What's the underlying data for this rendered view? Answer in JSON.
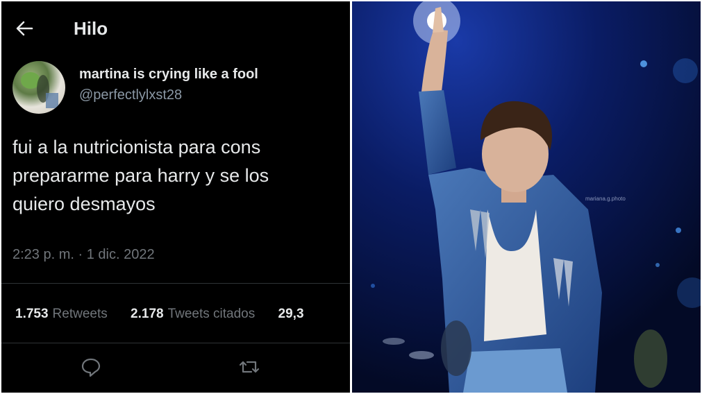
{
  "header": {
    "title": "Hilo",
    "back_icon": "arrow-left-icon"
  },
  "tweet": {
    "author_name": "martina is crying like a fool",
    "author_handle": "@perfectlylxst28",
    "text_lines": [
      "fui a la nutricionista para cons",
      "prepararme para harry y se los",
      "quiero desmayos"
    ],
    "timestamp": "2:23 p. m. · 1 dic. 2022",
    "stats": {
      "retweets_count": "1.753",
      "retweets_label": "Retweets",
      "quotes_count": "2.178",
      "quotes_label": "Tweets citados",
      "likes_count": "29,3"
    },
    "actions": [
      "reply-icon",
      "retweet-icon"
    ]
  },
  "photo": {
    "credit": "mariana.g.photo"
  },
  "colors": {
    "background": "#000000",
    "text": "#e7e9ea",
    "secondary": "#71767b",
    "divider": "#2f3336",
    "stage_blue": "#0b1f6e"
  }
}
